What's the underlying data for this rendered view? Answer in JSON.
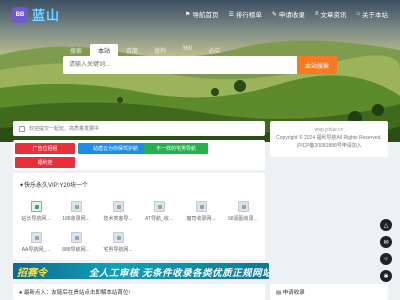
{
  "header": {
    "logo_badge": "BB",
    "logo_text": "蓝山",
    "nav": [
      {
        "icon": "⚑",
        "label": "导航首页"
      },
      {
        "icon": "☰",
        "label": "排行榜单"
      },
      {
        "icon": "✎",
        "label": "申请收录"
      },
      {
        "icon": "≡",
        "label": "文章资讯"
      },
      {
        "icon": "⌂",
        "label": "关于本站"
      }
    ]
  },
  "search": {
    "tabs": [
      "搜索",
      "本站",
      "百度",
      "搜狗",
      "360",
      "必应"
    ],
    "active_tab": "本站",
    "placeholder": "请输入关键词...",
    "button_label": "本站搜索"
  },
  "notice": {
    "text": "欢迎提交一起玩，高质量发展中"
  },
  "sidebar": {
    "site": "wap.jshlar.cn",
    "copyright": "Copyright © 2024 福利导航All Rights Reserved.",
    "icp": "沪ICP备20081888号申请加入"
  },
  "tag_buttons": [
    {
      "label": "广告位招租",
      "color": "#e8303a"
    },
    {
      "label": "站盾云为你保驾护航",
      "color": "#1d8ee5"
    },
    {
      "label": "不一样的宅男导航",
      "color": "#22b14c"
    },
    {
      "label": "福利连",
      "color": "#e8303a"
    }
  ],
  "favorites": {
    "title": "✦快乐永久VIP:Y20块一个",
    "items": [
      "站长导航网...",
      "188收录网...",
      "技术类客导...",
      "AT导航_收...",
      "魔司收录网...",
      "58源图收录...",
      "AA导航网_...",
      "888导航网...",
      "宅男导航网..."
    ]
  },
  "banner": {
    "left": "招赛令",
    "right": "全人工审核  无条件收录各类优质正规网站"
  },
  "bottom": {
    "left": "● 最新点入：友链后在贵站点击即解本站首位!",
    "right": "▤ 申请收录"
  },
  "float_buttons": [
    "△",
    "✉",
    "☼",
    "✱"
  ],
  "colors": {
    "accent": "#f47b20",
    "brand": "#6f5ad1"
  }
}
